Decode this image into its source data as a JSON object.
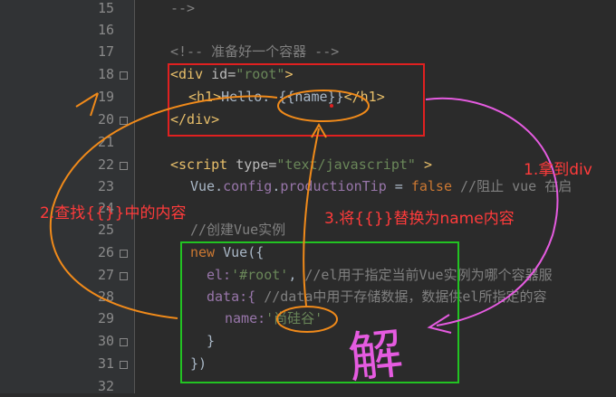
{
  "line_numbers": [
    "15",
    "16",
    "17",
    "18",
    "19",
    "20",
    "21",
    "22",
    "23",
    "24",
    "25",
    "26",
    "27",
    "28",
    "29",
    "30",
    "31",
    "32"
  ],
  "code": {
    "l15": "-->",
    "l17": "<!-- 准备好一个容器 -->",
    "l18_open": "<div",
    "l18_attr": " id=",
    "l18_val": "\"root\"",
    "l18_close": ">",
    "l19_h1open": "<h1>",
    "l19_text": "Hello. {{name}}",
    "l19_h1close": "</h1>",
    "l20": "</div>",
    "l22_open": "<script",
    "l22_attr": " type=",
    "l22_val": "\"text/javascript\"",
    "l22_close": " >",
    "l23_obj": "Vue.",
    "l23_config": "config",
    "l23_dot": ".",
    "l23_prop": "productionTip",
    "l23_eq": " = ",
    "l23_false": "false",
    "l23_comment": " //阻止 vue 在启",
    "l25_comment": "//创建Vue实例",
    "l26_new": "new ",
    "l26_rest": "Vue({",
    "l27_key": "el:",
    "l27_val": "'#root'",
    "l27_comma": ", ",
    "l27_comment": "//el用于指定当前Vue实例为哪个容器服",
    "l28_key": "data:{ ",
    "l28_comment": "//data中用于存储数据，数据供el所指定的容",
    "l29_key": "name:",
    "l29_val": "'尚硅谷'",
    "l30": "}",
    "l31": "})"
  },
  "annotations": {
    "step1": "1.拿到div",
    "step2": "2.查找{{}}中的内容",
    "step3": "3.将{{}}替换为name内容",
    "handwriting": "解"
  },
  "colors": {
    "red_box": "#e02020",
    "green_box": "#22c322",
    "orange": "#f08a1a",
    "magenta": "#e55be0",
    "annotation_red": "#ff3b3b"
  }
}
